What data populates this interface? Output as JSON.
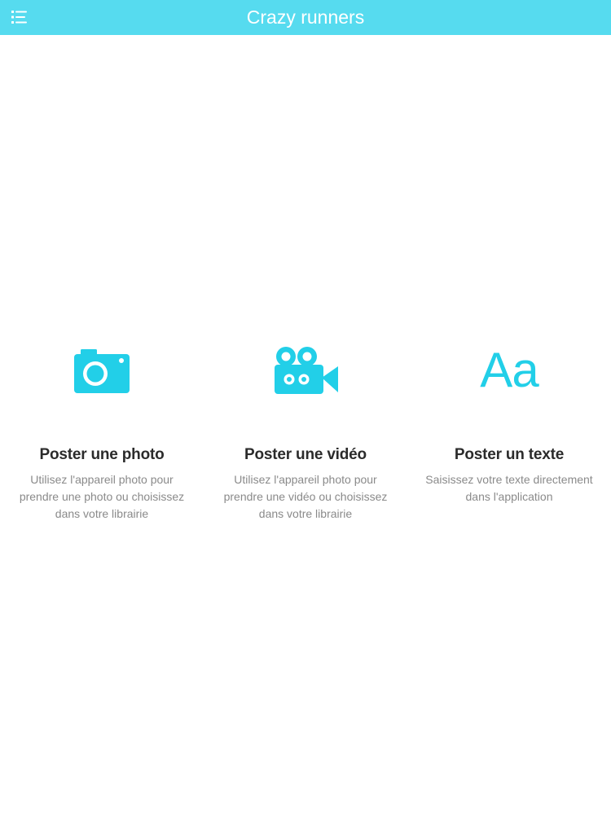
{
  "header": {
    "title": "Crazy runners",
    "menu_icon": "menu-list-icon",
    "background_color": "#56dbef",
    "title_color": "#ffffff"
  },
  "accent_color": "#22cfe8",
  "options": [
    {
      "icon": "camera-icon",
      "title": "Poster une photo",
      "description": "Utilisez l'appareil photo pour prendre une photo ou choisissez dans votre librairie"
    },
    {
      "icon": "video-camera-icon",
      "title": "Poster une vidéo",
      "description": "Utilisez l'appareil photo pour prendre une vidéo ou choisissez dans votre librairie"
    },
    {
      "icon": "text-icon",
      "icon_text": "Aa",
      "title": "Poster un texte",
      "description": "Saisissez votre texte directement dans l'application"
    }
  ]
}
